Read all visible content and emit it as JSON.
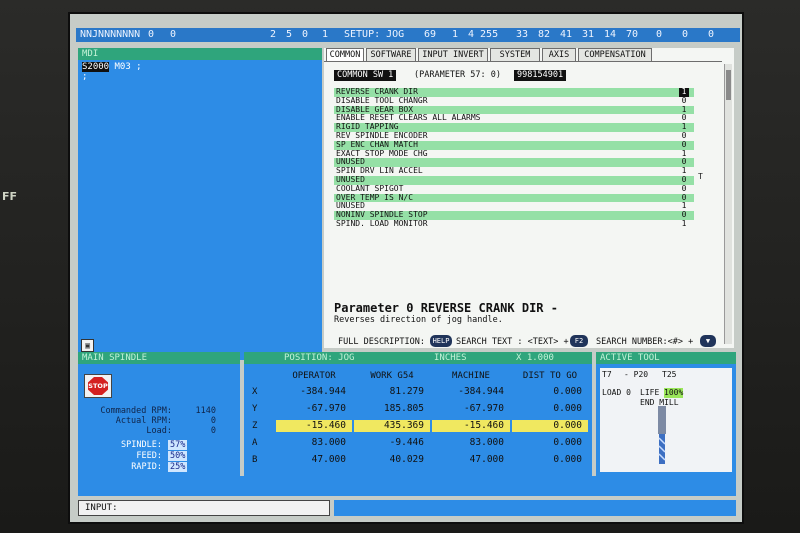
{
  "bezel": {
    "side_text": "FF"
  },
  "topbar": {
    "mode_text": "NNJNNNNNNN",
    "left_vals": [
      "0",
      "0"
    ],
    "mid_vals": [
      "2",
      "5",
      "0",
      "1"
    ],
    "setup_label": "SETUP: JOG",
    "right_vals": [
      "69",
      "1",
      "4 255",
      "33",
      "82",
      "41",
      "31",
      "14",
      "70",
      "0",
      "0",
      "0"
    ]
  },
  "program": {
    "header_left": "MDI",
    "header_right": "",
    "line1_hl": "S2000",
    "line1_rest": " M03 ;",
    "line2": ";"
  },
  "tabs": [
    "COMMON",
    "SOFTWARE",
    "INPUT INVERT",
    "SYSTEM",
    "AXIS",
    "COMPENSATION"
  ],
  "settings": {
    "sw_label": "COMMON SW 1",
    "param_text": "(PARAMETER  57: 0)",
    "param_value": "998154901",
    "bits": [
      {
        "label": "REVERSE CRANK DIR",
        "value": "1"
      },
      {
        "label": "DISABLE TOOL CHANGR",
        "value": "0"
      },
      {
        "label": "DISABLE GEAR BOX",
        "value": "1"
      },
      {
        "label": "ENABLE RESET CLEARS ALL ALARMS",
        "value": "0"
      },
      {
        "label": "RIGID TAPPING",
        "value": "1"
      },
      {
        "label": "REV SPINDLE ENCODER",
        "value": "0"
      },
      {
        "label": "SP ENC CHAN MATCH",
        "value": "0"
      },
      {
        "label": "EXACT STOP MODE CHG",
        "value": "1"
      },
      {
        "label": "UNUSED",
        "value": "0"
      },
      {
        "label": "SPIN DRV LIN ACCEL",
        "value": "1"
      },
      {
        "label": "UNUSED",
        "value": "0"
      },
      {
        "label": "COOLANT SPIGOT",
        "value": "0"
      },
      {
        "label": "OVER TEMP IS N/C",
        "value": "0"
      },
      {
        "label": "UNUSED",
        "value": "1"
      },
      {
        "label": "NONINV SPINDLE STOP",
        "value": "0"
      },
      {
        "label": "SPIND. LOAD MONITOR",
        "value": "1"
      }
    ],
    "cursor_char": "T",
    "desc_title": "Parameter 0 REVERSE CRANK DIR -",
    "desc_body": "Reverses direction of jog handle."
  },
  "helpbar": {
    "full_desc": "FULL DESCRIPTION:",
    "help_key": "HELP",
    "search_text": "SEARCH TEXT : <TEXT> +",
    "f2_key": "F2",
    "search_number": "SEARCH NUMBER:<#> +",
    "down_key": "▼"
  },
  "spindle": {
    "header": "MAIN SPINDLE",
    "stop_label": "STOP",
    "commanded_label": "Commanded RPM:",
    "commanded_value": "1140",
    "actual_label": "Actual RPM:",
    "actual_value": "0",
    "load_label": "Load:",
    "load_value": "0",
    "spindle_label": "SPINDLE:",
    "spindle_pct": "57%",
    "feed_label": "FEED:",
    "feed_pct": "50%",
    "rapid_label": "RAPID:",
    "rapid_pct": "25%"
  },
  "positions": {
    "header_left": "POSITION: JOG",
    "header_mid": "INCHES",
    "header_right": "X 1.000",
    "columns": [
      "OPERATOR",
      "WORK  G54",
      "MACHINE",
      "DIST TO GO"
    ],
    "rows": [
      {
        "axis": "X",
        "values": [
          "-384.944",
          "81.279",
          "-384.944",
          "0.000"
        ]
      },
      {
        "axis": "Y",
        "values": [
          "-67.970",
          "185.805",
          "-67.970",
          "0.000"
        ]
      },
      {
        "axis": "Z",
        "values": [
          "-15.460",
          "435.369",
          "-15.460",
          "0.000"
        ]
      },
      {
        "axis": "A",
        "values": [
          "83.000",
          "-9.446",
          "83.000",
          "0.000"
        ]
      },
      {
        "axis": "B",
        "values": [
          "47.000",
          "40.029",
          "47.000",
          "0.000"
        ]
      }
    ]
  },
  "tool": {
    "header": "ACTIVE TOOL",
    "tool_num": "T7",
    "pocket": "- P20",
    "tool25": "T25",
    "load_label": "LOAD 0",
    "life_label": "LIFE",
    "life_value": "100%",
    "type": "END MILL"
  },
  "input": {
    "label": "INPUT:",
    "value": ""
  },
  "colors": {
    "panel_blue": "#2d8ce6",
    "header_green": "#2fa57c",
    "row_green": "#95e0a6",
    "highlight_yellow": "#f0e860",
    "stop_red": "#d42020"
  }
}
